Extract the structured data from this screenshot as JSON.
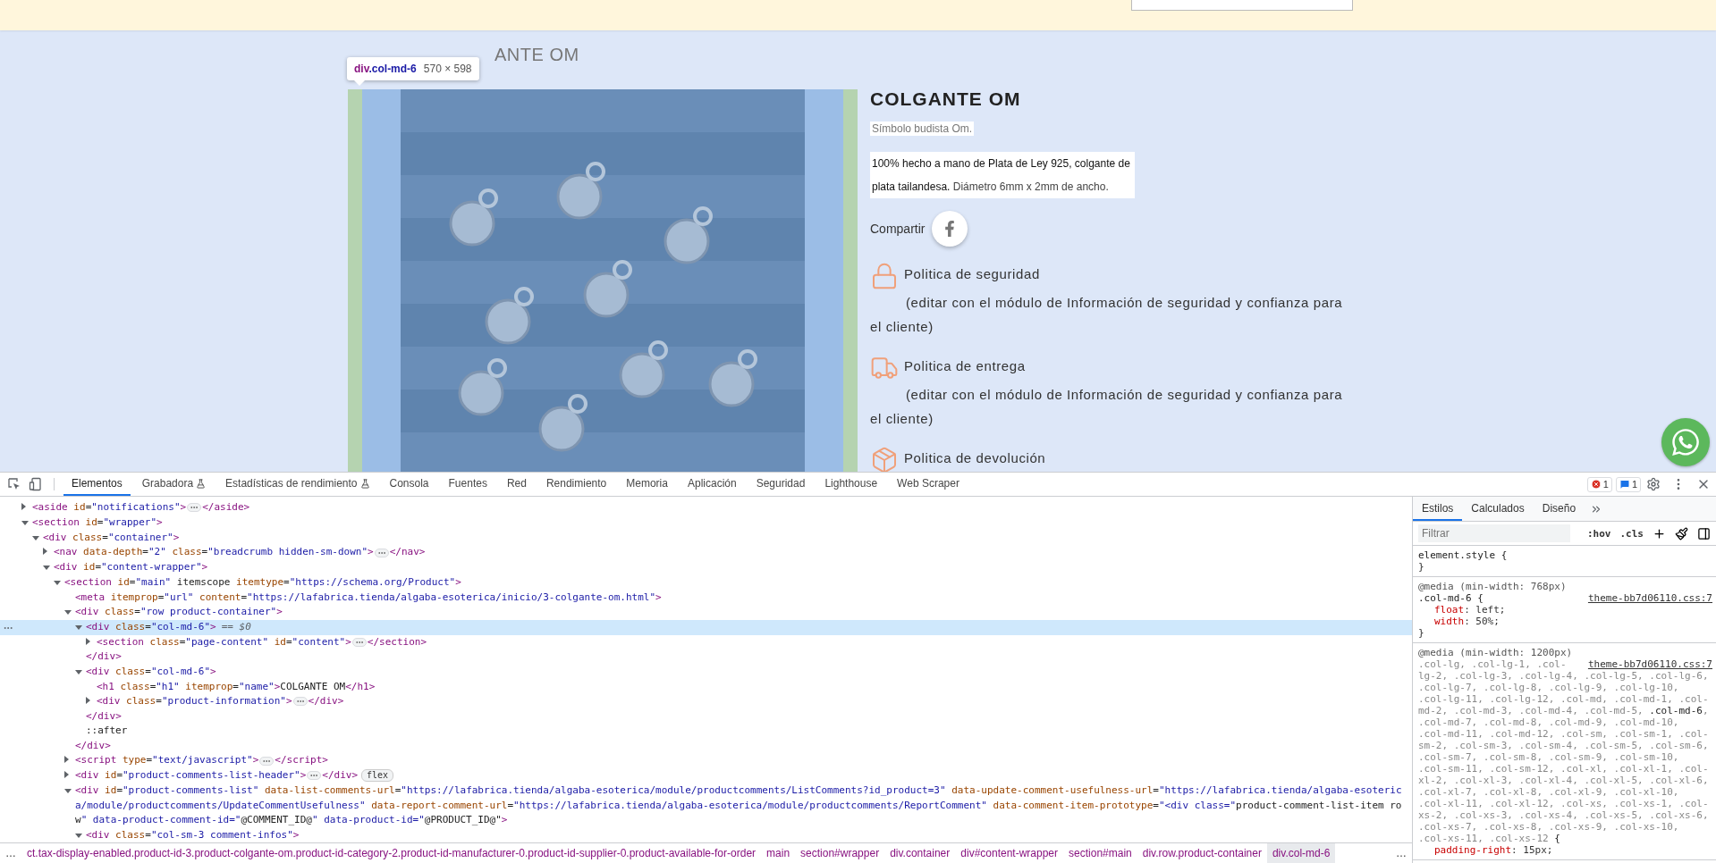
{
  "page": {
    "breadcrumb_title": "ANTE OM",
    "inspect_tooltip": {
      "tag": "div",
      "class_name": ".col-md-6",
      "size": "570 × 598"
    },
    "product": {
      "title": "COLGANTE OM",
      "summary": "Símbolo budista Om.",
      "description": [
        {
          "text": "100% hecho a mano de Plata de Ley 925, colgante de plata tailandesa.",
          "kind": "lead"
        },
        {
          "text": " Diámetro 6mm x 2mm de ancho.",
          "kind": "detail"
        }
      ],
      "share_label": "Compartir",
      "reassurance": [
        {
          "kind": "lock",
          "title": "Politica de seguridad",
          "text": "(editar con el módulo de Información de seguridad y confianza para el cliente)"
        },
        {
          "kind": "truck",
          "title": "Politica de entrega",
          "text": "(editar con el módulo de Información de seguridad y confianza para el cliente)"
        },
        {
          "kind": "package",
          "title": "Politica de devolución"
        }
      ]
    }
  },
  "devtools": {
    "tabs": [
      {
        "label": "Elementos",
        "selected": true,
        "experimental": false
      },
      {
        "label": "Grabadora",
        "selected": false,
        "experimental": true
      },
      {
        "label": "Estadísticas de rendimiento",
        "selected": false,
        "experimental": true
      },
      {
        "label": "Consola",
        "selected": false,
        "experimental": false
      },
      {
        "label": "Fuentes",
        "selected": false,
        "experimental": false
      },
      {
        "label": "Red",
        "selected": false,
        "experimental": false
      },
      {
        "label": "Rendimiento",
        "selected": false,
        "experimental": false
      },
      {
        "label": "Memoria",
        "selected": false,
        "experimental": false
      },
      {
        "label": "Aplicación",
        "selected": false,
        "experimental": false
      },
      {
        "label": "Seguridad",
        "selected": false,
        "experimental": false
      },
      {
        "label": "Lighthouse",
        "selected": false,
        "experimental": false
      },
      {
        "label": "Web Scraper",
        "selected": false,
        "experimental": false
      }
    ],
    "issues": {
      "errors": "1",
      "messages": "1"
    },
    "elements": {
      "tree": [
        {
          "kind": "node",
          "open": "<aside id=\"notifications\">",
          "close": "</aside>",
          "expanded": false,
          "selected": false
        },
        {
          "kind": "node",
          "open": "<section id=\"wrapper\">",
          "expanded": true,
          "selected": false,
          "children": [
            {
              "kind": "node",
              "open": "<div class=\"container\">",
              "expanded": true,
              "selected": false,
              "children": [
                {
                  "kind": "node",
                  "open": "<nav data-depth=\"2\" class=\"breadcrumb hidden-sm-down\">",
                  "close": "</nav>",
                  "expanded": false,
                  "selected": false
                },
                {
                  "kind": "node",
                  "open": "<div id=\"content-wrapper\">",
                  "expanded": true,
                  "selected": false,
                  "children": [
                    {
                      "kind": "node",
                      "open": "<section id=\"main\" itemscope itemtype=\"https://schema.org/Product\">",
                      "expanded": true,
                      "selected": false,
                      "children": [
                        {
                          "kind": "leaf",
                          "open": "<meta itemprop=\"url\" content=\"https://lafabrica.tienda/algaba-esoterica/inicio/3-colgante-om.html\">",
                          "selected": false
                        },
                        {
                          "kind": "node",
                          "open": "<div class=\"row product-container\">",
                          "close": "</div>",
                          "expanded": true,
                          "selected": false,
                          "children": [
                            {
                              "kind": "node",
                              "open": "<div class=\"col-md-6\">",
                              "marker": "== $0",
                              "close": "</div>",
                              "expanded": true,
                              "selected": true,
                              "children": [
                                {
                                  "kind": "node",
                                  "open": "<section class=\"page-content\" id=\"content\">",
                                  "close": "</section>",
                                  "expanded": false,
                                  "selected": false
                                }
                              ]
                            },
                            {
                              "kind": "node",
                              "open": "<div class=\"col-md-6\">",
                              "close": "</div>",
                              "expanded": true,
                              "selected": false,
                              "children": [
                                {
                                  "kind": "leaf",
                                  "open": "<h1 class=\"h1\" itemprop=\"name\">COLGANTE OM</h1>",
                                  "selected": false
                                },
                                {
                                  "kind": "node",
                                  "open": "<div class=\"product-information\">",
                                  "close": "</div>",
                                  "expanded": false,
                                  "selected": false
                                }
                              ]
                            },
                            {
                              "kind": "leaf",
                              "open": "::after",
                              "selected": false
                            }
                          ]
                        },
                        {
                          "kind": "node",
                          "open": "<script type=\"text/javascript\">",
                          "close": "</script>",
                          "expanded": false,
                          "selected": false
                        },
                        {
                          "kind": "node",
                          "open": "<div id=\"product-comments-list-header\">",
                          "close": "</div>",
                          "badge": "flex",
                          "expanded": false,
                          "selected": false
                        },
                        {
                          "kind": "node",
                          "open": "<div id=\"product-comments-list\" data-list-comments-url=\"https://lafabrica.tienda/algaba-esoterica/module/productcomments/ListComments?id_product=3\" data-update-comment-usefulness-url=\"https://lafabrica.tienda/algaba-esoterica/module/productcomments/UpdateCommentUsefulness\" data-report-comment-url=\"https://lafabrica.tienda/algaba-esoterica/module/productcomments/ReportComment\" data-comment-item-prototype=\"<div class=\"product-comment-list-item row\" data-product-comment-id=\"@COMMENT_ID@\" data-product-id=\"@PRODUCT_ID@\">",
                          "expanded": true,
                          "selected": false,
                          "children": [
                            {
                              "kind": "node",
                              "open": "<div class=\"col-sm-3 comment-infos\">",
                              "expanded": true,
                              "selected": false
                            }
                          ]
                        }
                      ]
                    }
                  ]
                }
              ]
            }
          ]
        }
      ]
    },
    "breadcrumbs": {
      "overflow_left": "…",
      "overflow_right": "…",
      "items": [
        {
          "text": "ct.tax-display-enabled.product-id-3.product-colgante-om.product-id-category-2.product-id-manufacturer-0.product-id-supplier-0.product-available-for-order",
          "selected": false
        },
        {
          "text": "main",
          "selected": false
        },
        {
          "text": "section#wrapper",
          "selected": false
        },
        {
          "text": "div.container",
          "selected": false
        },
        {
          "text": "div#content-wrapper",
          "selected": false
        },
        {
          "text": "section#main",
          "selected": false
        },
        {
          "text": "div.row.product-container",
          "selected": false
        },
        {
          "text": "div.col-md-6",
          "selected": true
        }
      ]
    },
    "styles": {
      "tabs": [
        {
          "label": "Estilos",
          "selected": true
        },
        {
          "label": "Calculados",
          "selected": false
        },
        {
          "label": "Diseño",
          "selected": false
        }
      ],
      "filter_placeholder": "Filtrar",
      "toggles": [
        ":hov",
        ".cls"
      ],
      "rules": [
        {
          "selector_head": [
            {
              "text": "element.style",
              "matched": true
            },
            {
              "text": " {",
              "matched": true
            }
          ],
          "close": "}"
        },
        {
          "media": "@media (min-width: 768px)",
          "source": "theme-bb7d06110.css:7",
          "selector_head": [
            {
              "text": ".col-md-6",
              "matched": true
            },
            {
              "text": " {",
              "matched": true
            }
          ],
          "declarations": [
            {
              "property": "float",
              "rest": ": left;"
            },
            {
              "property": "width",
              "rest": ": 50%;"
            }
          ],
          "close": "}"
        },
        {
          "media": "@media (min-width: 1200px)",
          "source": "theme-bb7d06110.css:7",
          "selector_head": [
            {
              "text": ".col-lg, .col-lg-1, .col-",
              "matched": false
            }
          ],
          "selector_parts": [
            {
              "text": "lg-2, .col-lg-3, .col-lg-4, .col-lg-5, .col-lg-6, .col-lg-7, .col-lg-8, .col-lg-9, .col-lg-10, .col-lg-11, .col-lg-12, .col-md, .col-md-1, .col-md-2, .col-md-3, .col-md-4, .col-md-5, ",
              "matched": false
            },
            {
              "text": ".col-md-6",
              "matched": true
            },
            {
              "text": ", .col-md-7, .col-md-8, .col-md-9, .col-md-10, .col-md-11, .col-md-12, .col-sm, .col-sm-1, .col-sm-2, .col-sm-3, .col-sm-4, .col-sm-5, .col-sm-6, .col-sm-7, .col-sm-8, .col-sm-9, .col-sm-10, .col-sm-11, .col-sm-12, .col-xl, .col-xl-1, .col-xl-2, .col-xl-3, .col-xl-4, .col-xl-5, .col-xl-6, .col-xl-7, .col-xl-8, .col-xl-9, .col-xl-10, .col-xl-11, .col-xl-12, .col-xs, .col-xs-1, .col-xs-2, .col-xs-3, .col-xs-4, .col-xs-5, .col-xs-6, .col-xs-7, .col-xs-8, .col-xs-9, .col-xs-10, .col-xs-11, .col-xs-12",
              "matched": false
            },
            {
              "text": " {",
              "matched": true
            }
          ],
          "declarations": [
            {
              "property": "padding-right",
              "rest": ": 15px;"
            }
          ]
        }
      ]
    }
  }
}
